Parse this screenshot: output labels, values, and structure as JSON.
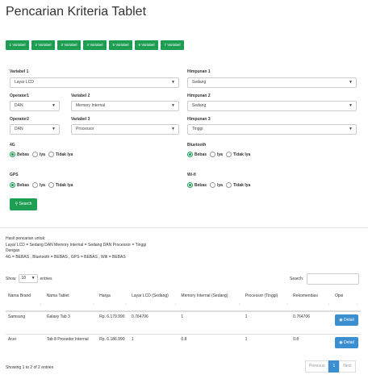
{
  "page": {
    "title": "Pencarian Kriteria Tablet"
  },
  "variable_buttons": [
    "1 Variabel",
    "2 Variabel",
    "3 Variabel",
    "4 Variabel",
    "5 Variabel",
    "6 Variabel",
    "7 Variabel"
  ],
  "form": {
    "variabel1": {
      "label": "Variabel 1",
      "value": "Layar LCD"
    },
    "himpunan1": {
      "label": "Himpunan 1",
      "value": "Sedang"
    },
    "operator1": {
      "label": "Operator1",
      "value": "DAN"
    },
    "variabel2": {
      "label": "Variabel 2",
      "value": "Memory Internal"
    },
    "himpunan2": {
      "label": "Himpunan 2",
      "value": "Sedang"
    },
    "operator2": {
      "label": "Operator2",
      "value": "DAN"
    },
    "variabel3": {
      "label": "Variabel 3",
      "value": "Processor"
    },
    "himpunan3": {
      "label": "Himpunan 3",
      "value": "Tinggi"
    },
    "caret": "▼",
    "options": {
      "bebas": "Bebas",
      "iya": "Iya",
      "tidak": "Tidak Iya"
    },
    "g4": {
      "label": "4G"
    },
    "bluetooth": {
      "label": "Bluetooth"
    },
    "gps": {
      "label": "GPS"
    },
    "wifi": {
      "label": "Wi-fi"
    },
    "search_label": "Search"
  },
  "result": {
    "line1": "Hasil pencarian untuk:",
    "line2": "Layar LCD = Sedang DAN Memory Internal = Sedang DAN Processor = Tinggi",
    "line3": "Dengan",
    "line4": "4G = BEBAS , Bluetooth = BEBAS , GPS = BEBAS , Wifi = BEBAS"
  },
  "table_controls": {
    "show": "Show",
    "entries_value": "10",
    "entries": "entries",
    "search": "Search:"
  },
  "table": {
    "headers": [
      "Nama Brand",
      "Nama Tablet",
      "Harga",
      "Layar LCD (Sedang)",
      "Memory Internal (Sedang)",
      "Processor (Tinggi)",
      "Rekomendasi",
      "Opsi"
    ],
    "rows": [
      {
        "brand": "Samsung",
        "tablet": "Galaxy Tab 3",
        "harga": "Rp. 6.179.990",
        "lcd": "0.764706",
        "memory": "1",
        "processor": "1",
        "rekomendasi": "0.764706",
        "opsi": "Detail"
      },
      {
        "brand": "Acer",
        "tablet": "Tab 8 Prosedor Internal",
        "harga": "Rp. 6.186.990",
        "lcd": "1",
        "memory": "0.8",
        "processor": "1",
        "rekomendasi": "0.8",
        "opsi": "Detail"
      }
    ]
  },
  "footer": {
    "info": "Showing 1 to 2 of 2 entries",
    "prev": "Previous",
    "page": "1",
    "next": "Next"
  }
}
